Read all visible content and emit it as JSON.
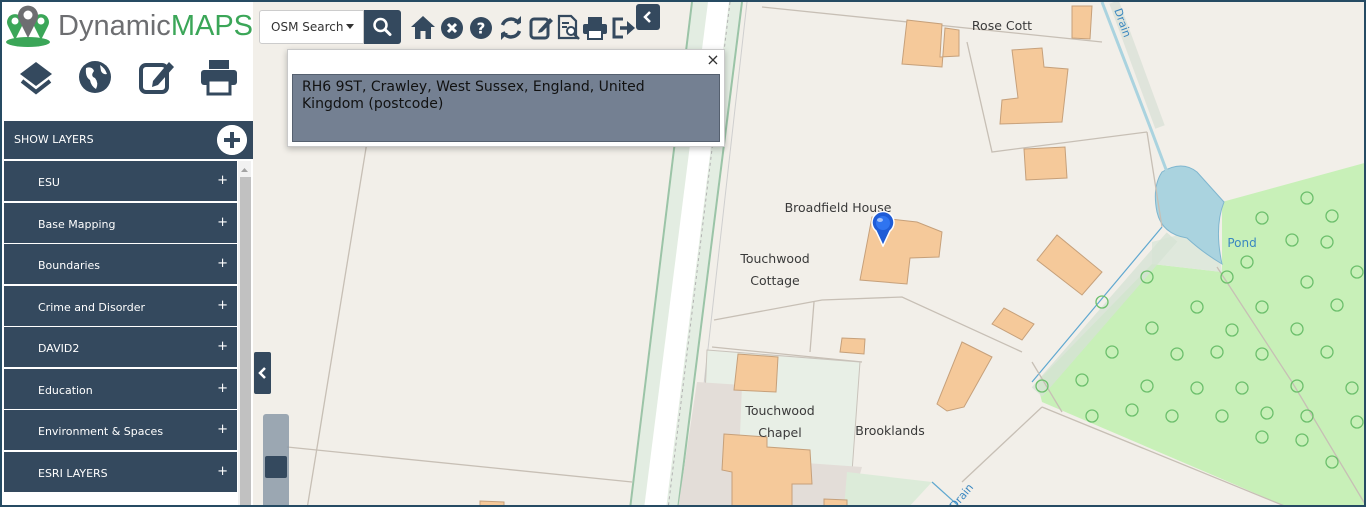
{
  "app": {
    "logo_part1": "Dynamic",
    "logo_part2": "MAPS"
  },
  "sidebar": {
    "tools": [
      {
        "name": "layers-icon"
      },
      {
        "name": "globe-icon"
      },
      {
        "name": "edit-icon"
      },
      {
        "name": "print-icon"
      }
    ],
    "show_layers_label": "SHOW LAYERS",
    "layers": [
      {
        "label": "ESU"
      },
      {
        "label": "Base Mapping"
      },
      {
        "label": "Boundaries"
      },
      {
        "label": "Crime and Disorder"
      },
      {
        "label": "DAVID2"
      },
      {
        "label": "Education"
      },
      {
        "label": "Environment & Spaces"
      },
      {
        "label": "ESRI LAYERS"
      }
    ],
    "expand_symbol": "+"
  },
  "toolbar": {
    "search_source": "OSM Search",
    "icons": [
      "home-icon",
      "clear-icon",
      "help-icon",
      "refresh-icon",
      "edit-icon",
      "report-icon",
      "print-icon",
      "logout-icon"
    ]
  },
  "popup": {
    "close_symbol": "×",
    "result_text": "RH6 9ST, Crawley, West Sussex, England, United Kingdom (postcode)"
  },
  "map": {
    "labels": {
      "rose_cott": "Rose Cott",
      "broadfield_house": "Broadfield House",
      "touchwood_cottage": "Touchwood\nCottage",
      "touchwood_chapel": "Touchwood\nChapel",
      "brooklands": "Brooklands",
      "pond": "Pond",
      "drain_top": "Drain",
      "drain_bottom": "Drain"
    }
  },
  "colors": {
    "sidebar_bg": "#34495e",
    "map_bg": "#f2efe9",
    "building": "#f5c99a",
    "woodland": "#c8f0b8",
    "water": "#aad3df",
    "road_edge": "#9bc4a7",
    "logo_grey": "#6d6e71",
    "logo_green": "#3ba658",
    "marker_blue": "#1f5cd6"
  }
}
